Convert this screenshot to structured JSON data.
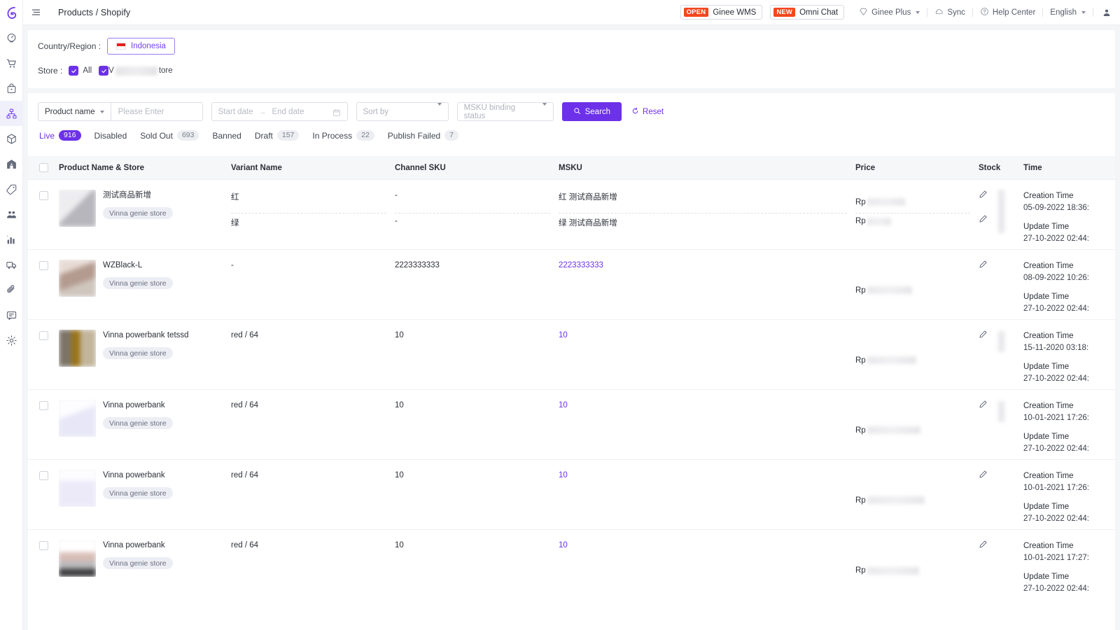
{
  "brand": {
    "logo_name": "ginee-logo",
    "accent": "#6c31e8"
  },
  "header": {
    "breadcrumb": "Products / Shopify",
    "menu_icon": "hamburger-icon",
    "buttons": [
      {
        "tag": "OPEN",
        "label": "Ginee WMS"
      },
      {
        "tag": "NEW",
        "label": "Omni Chat"
      }
    ],
    "links": [
      {
        "label": "Ginee Plus",
        "icon": "diamond-icon",
        "caret": true
      },
      {
        "label": "Sync",
        "icon": "cloud-sync-icon",
        "caret": false
      },
      {
        "label": "Help Center",
        "icon": "question-circle-icon",
        "caret": false
      },
      {
        "label": "English",
        "icon": "",
        "caret": true
      }
    ],
    "avatar": "user-avatar-icon"
  },
  "sidebar": {
    "items": [
      {
        "name": "dashboard",
        "icon": "gauge-icon",
        "active": false
      },
      {
        "name": "orders",
        "icon": "shopping-cart-icon",
        "active": false
      },
      {
        "name": "purchase",
        "icon": "bag-icon",
        "active": false
      },
      {
        "name": "products",
        "icon": "sitemap-icon",
        "active": true
      },
      {
        "name": "inventory",
        "icon": "box-icon",
        "active": false
      },
      {
        "name": "warehouse",
        "icon": "warehouse-icon",
        "active": false
      },
      {
        "name": "promotion",
        "icon": "tag-icon",
        "active": false
      },
      {
        "name": "customers",
        "icon": "users-icon",
        "active": false
      },
      {
        "name": "reports",
        "icon": "bar-chart-icon",
        "active": false
      },
      {
        "name": "shipping",
        "icon": "truck-icon",
        "active": false
      },
      {
        "name": "integrations",
        "icon": "link-icon",
        "active": false
      },
      {
        "name": "chat",
        "icon": "chat-icon",
        "active": false
      },
      {
        "name": "settings",
        "icon": "gear-icon",
        "active": false
      }
    ]
  },
  "filters": {
    "country_label": "Country/Region :",
    "country_value": "Indonesia",
    "country_flag": "indonesia-flag-icon",
    "store_label": "Store :",
    "store_all_label": "All",
    "store_name_suffix": "tore",
    "store_name_prefix": "V"
  },
  "search": {
    "field_selector": "Product name",
    "input_placeholder": "Please Enter",
    "input_value": "",
    "start_date_placeholder": "Start date",
    "end_date_placeholder": "End date",
    "date_arrow": "→",
    "sort_placeholder": "Sort by",
    "msku_placeholder": "MSKU binding status",
    "search_label": "Search",
    "reset_label": "Reset"
  },
  "tabs": [
    {
      "label": "Live",
      "count": "916",
      "active": true
    },
    {
      "label": "Disabled",
      "count": "",
      "active": false
    },
    {
      "label": "Sold Out",
      "count": "693",
      "active": false
    },
    {
      "label": "Banned",
      "count": "",
      "active": false
    },
    {
      "label": "Draft",
      "count": "157",
      "active": false
    },
    {
      "label": "In Process",
      "count": "22",
      "active": false
    },
    {
      "label": "Publish Failed",
      "count": "7",
      "active": false
    }
  ],
  "table": {
    "columns": {
      "product": "Product Name & Store",
      "variant": "Variant Name",
      "channel_sku": "Channel SKU",
      "msku": "MSKU",
      "price": "Price",
      "stock": "Stock",
      "time": "Time"
    },
    "creation_label": "Creation Time",
    "update_label": "Update Time",
    "rows": [
      {
        "product_name": "测试商品新增",
        "store": "Vinna genie store",
        "thumb_colors": [
          "#ededf0",
          "#9a9aa0",
          "#cfcfd4",
          "#8e8e95"
        ],
        "split": true,
        "variant_1": "红",
        "variant_2": "绿",
        "channel_sku_1": "-",
        "channel_sku_2": "-",
        "msku_1": "红 测试商品新增",
        "msku_2": "绿 测试商品新增",
        "price_1": "Rp",
        "price_2": "Rp",
        "creation_time": "05-09-2022 18:36:",
        "update_time": "27-10-2022 02:44:"
      },
      {
        "product_name": "WZBlack-L",
        "store": "Vinna genie store",
        "thumb_colors": [
          "#d8c6bd",
          "#efe9e4",
          "#b49b90",
          "#cfc6bd"
        ],
        "split": false,
        "variant_1": "-",
        "channel_sku_1": "2223333333",
        "msku_1": "2223333333",
        "price_1": "Rp",
        "creation_time": "08-09-2022 10:26:",
        "update_time": "27-10-2022 02:44:"
      },
      {
        "product_name": "Vinna powerbank tetssd",
        "store": "Vinna genie store",
        "thumb_colors": [
          "#7d7468",
          "#9b7418",
          "#b8a98f",
          "#d2a321"
        ],
        "split": false,
        "variant_1": "red / 64",
        "channel_sku_1": "10",
        "msku_1": "10",
        "price_1": "Rp",
        "creation_time": "15-11-2020 03:18:",
        "update_time": "27-10-2022 02:44:"
      },
      {
        "product_name": "Vinna powerbank",
        "store": "Vinna genie store",
        "thumb_colors": [
          "#f2f1fb",
          "#e8e7f8",
          "#f6f5fd",
          "#ecebf9"
        ],
        "split": false,
        "variant_1": "red / 64",
        "channel_sku_1": "10",
        "msku_1": "10",
        "price_1": "Rp",
        "creation_time": "10-01-2021 17:26:",
        "update_time": "27-10-2022 02:44:"
      },
      {
        "product_name": "Vinna powerbank",
        "store": "Vinna genie store",
        "thumb_colors": [
          "#f3f2fc",
          "#eceaf9",
          "#f7f6fe",
          "#e9e8f7"
        ],
        "split": false,
        "variant_1": "red / 64",
        "channel_sku_1": "10",
        "msku_1": "10",
        "price_1": "Rp",
        "creation_time": "10-01-2021 17:26:",
        "update_time": "27-10-2022 02:44:"
      },
      {
        "product_name": "Vinna powerbank",
        "store": "Vinna genie store",
        "thumb_colors": [
          "#f7f3f2",
          "#d9bdb6",
          "#b9b9bb",
          "#3c3c3e"
        ],
        "split": false,
        "variant_1": "red / 64",
        "channel_sku_1": "10",
        "msku_1": "10",
        "price_1": "Rp",
        "creation_time": "10-01-2021 17:27:",
        "update_time": "27-10-2022 02:44:"
      }
    ]
  }
}
